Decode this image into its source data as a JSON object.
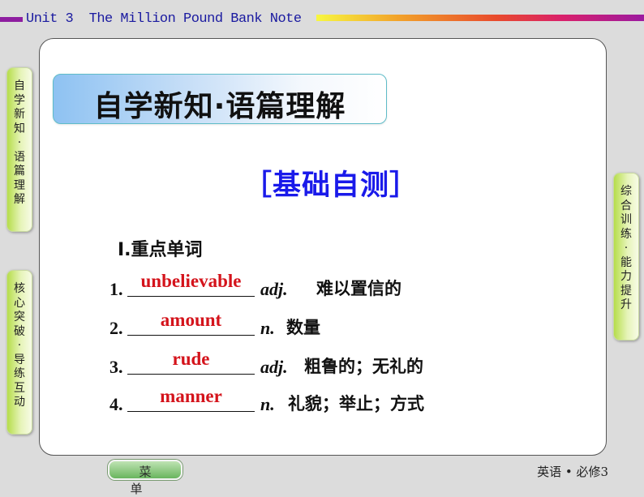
{
  "header": {
    "title": "Unit 3  The Million Pound Bank Note",
    "accent_colors": {
      "left_bar": "#8e1ea0",
      "title_text": "#1a1aa0",
      "gradient_stops": [
        "#f7f741",
        "#f2a22a",
        "#e84a2c",
        "#d9206b",
        "#9b1aa0"
      ]
    }
  },
  "main": {
    "section_title": "自学新知·语篇理解",
    "subsection": "［基础自测］",
    "vocab_heading": "Ⅰ.重点单词",
    "vocab_items": [
      {
        "number": "1.",
        "answer": "unbelievable",
        "pos": "adj.",
        "meaning": "难以置信的"
      },
      {
        "number": "2.",
        "answer": "amount",
        "pos": "n.",
        "meaning": "数量"
      },
      {
        "number": "3.",
        "answer": "rude",
        "pos": "adj.",
        "meaning": "粗鲁的；无礼的"
      },
      {
        "number": "4.",
        "answer": "manner",
        "pos": "n.",
        "meaning": "礼貌；举止；方式"
      }
    ],
    "answer_color": "#d4131b",
    "subsection_color": "#1a1aea"
  },
  "side_tabs": {
    "left_top": "自学新知·语篇理解",
    "left_bottom": "核心突破·导练互动",
    "right": "综合训练·能力提升"
  },
  "footer": {
    "menu_label": "菜单",
    "book_label": "英语 • 必修3"
  }
}
